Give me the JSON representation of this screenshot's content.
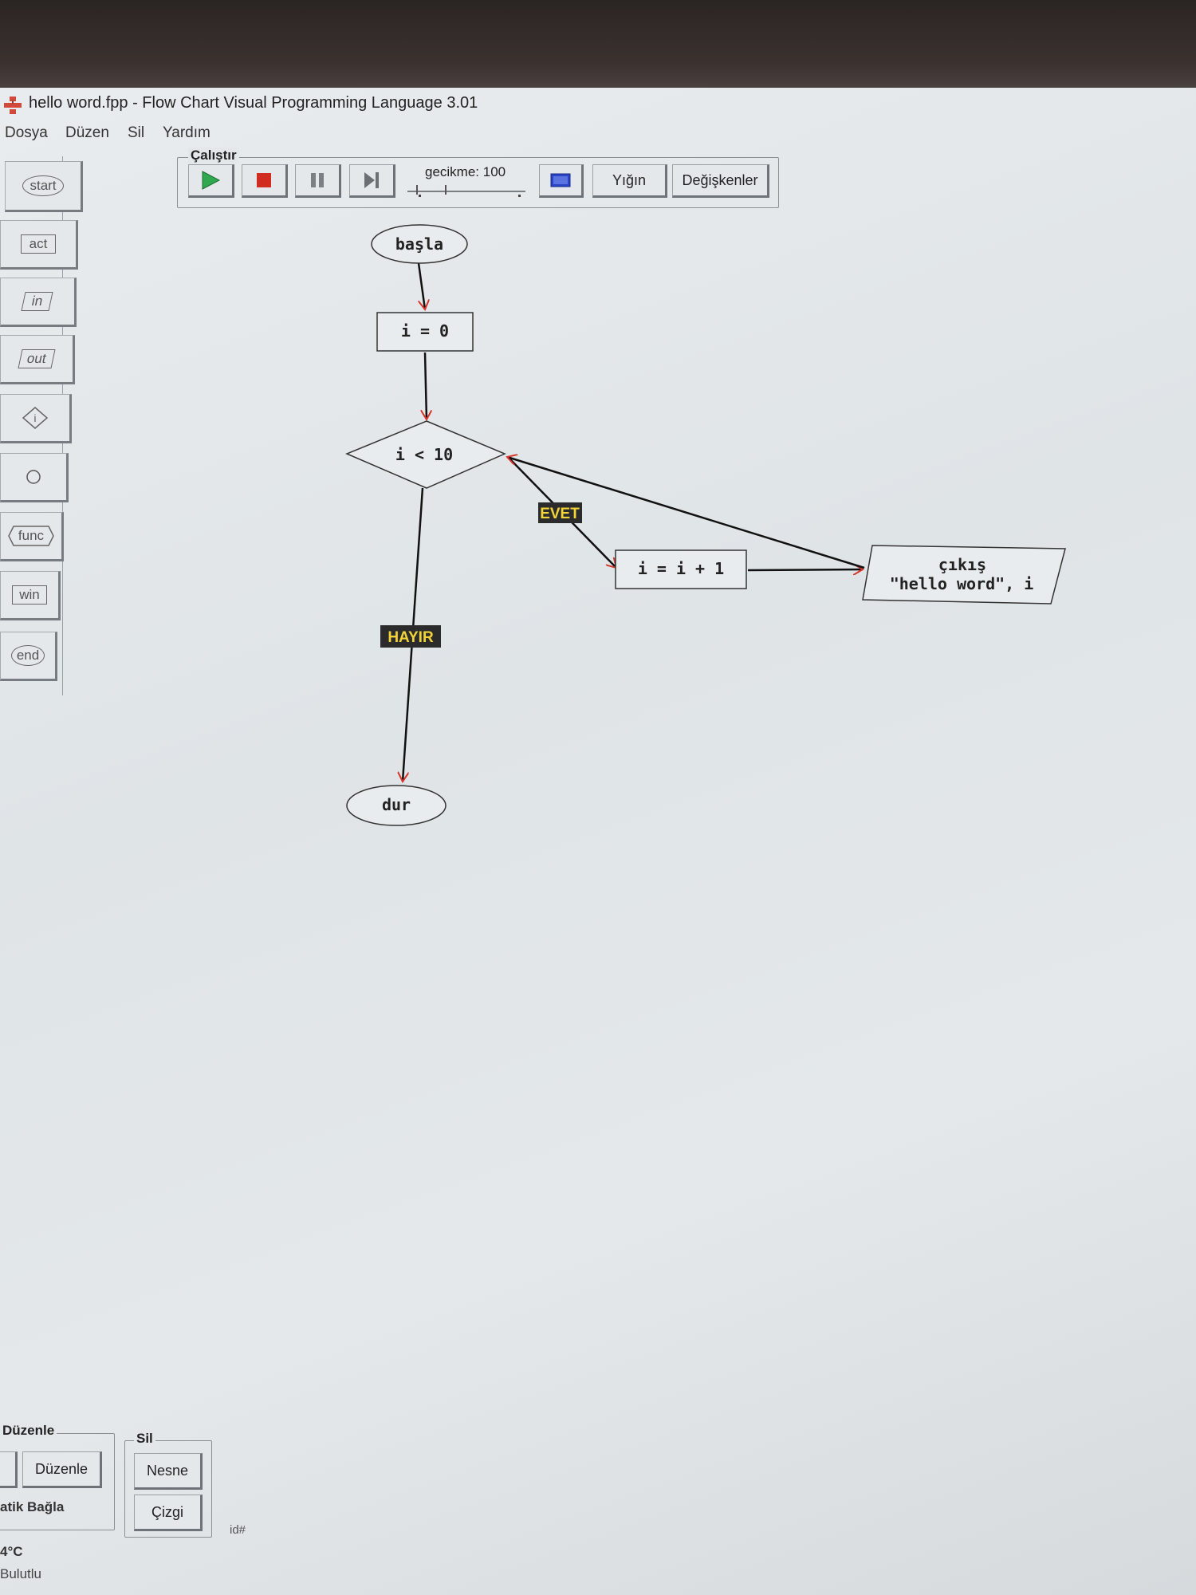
{
  "window": {
    "title": "hello word.fpp - Flow Chart Visual Programming Language 3.01"
  },
  "menu": [
    "Dosya",
    "Düzen",
    "Sil",
    "Yardım"
  ],
  "toolbar": {
    "group_label": "Çalıştır",
    "delay_label": "gecikme: 100",
    "stack_label": "Yığın",
    "variables_label": "Değişkenler"
  },
  "palette": [
    "start",
    "act",
    "in",
    "out",
    "if",
    "",
    "func",
    "win",
    "end"
  ],
  "flowchart": {
    "start_label": "başla",
    "init_label": "i = 0",
    "condition_label": "i < 10",
    "increment_label": "i = i + 1",
    "output_title": "çıkış",
    "output_value": "\"hello word\", i",
    "yes_label": "EVET",
    "no_label": "HAYIR",
    "end_label": "dur"
  },
  "bottom": {
    "edit_group_label": "Düzenle",
    "edit_button": "Düzenle",
    "auto_connect_label": "atik Bağla",
    "delete_group_label": "Sil",
    "object_button": "Nesne",
    "line_button": "Çizgi",
    "id_label": "id#"
  },
  "taskbar": {
    "temperature": "4°C",
    "weather": "Bulutlu"
  },
  "colors": {
    "label_bg": "#2b2b2b",
    "label_text": "#f2d43a",
    "arrow_head": "#d6342a",
    "run_green": "#2fa84f",
    "stop_red": "#d02c1f"
  }
}
